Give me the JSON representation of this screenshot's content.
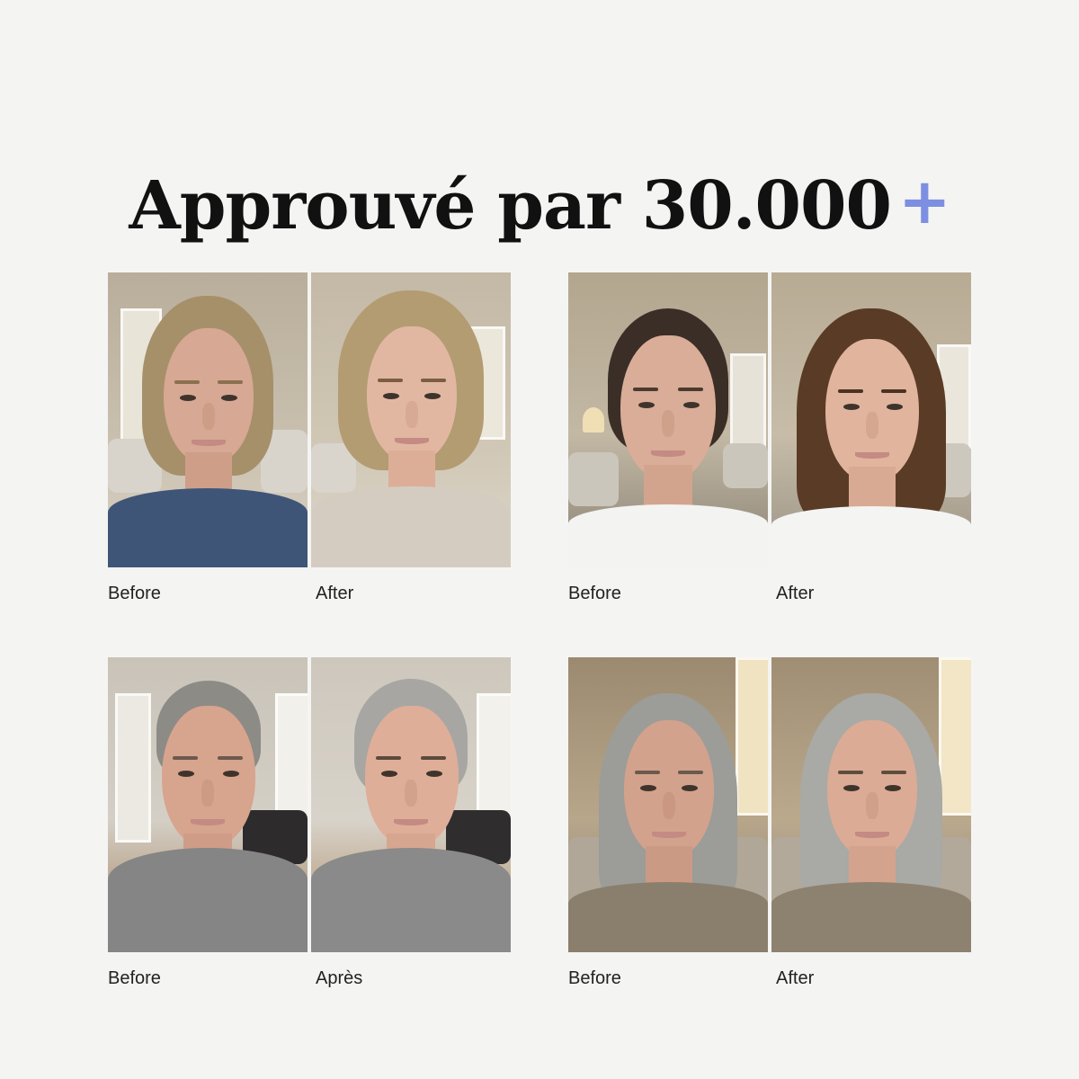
{
  "headline": {
    "text": "Approuvé par 30.000",
    "plus": "+"
  },
  "accent_color": "#7d8fe0",
  "pairs": [
    {
      "before_label": "Before",
      "after_label": "After"
    },
    {
      "before_label": "Before",
      "after_label": "After"
    },
    {
      "before_label": "Before",
      "after_label": "Après"
    },
    {
      "before_label": "Before",
      "after_label": "After"
    }
  ]
}
